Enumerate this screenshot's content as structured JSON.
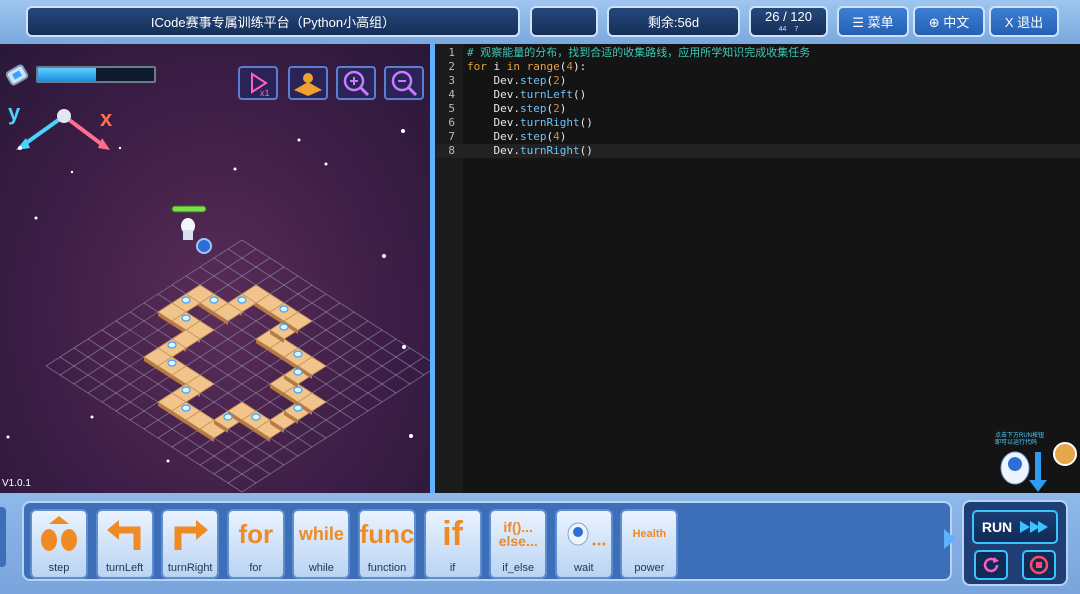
{
  "header": {
    "title": "ICode赛事专属训练平台（Python小高组）",
    "remaining": "剩余:56d",
    "counter_main": "26 / 120",
    "counter_sub_a": "44",
    "counter_sub_b": "7",
    "menu_label": "☰ 菜单",
    "lang_label": "⊕ 中文",
    "exit_label": "X 退出"
  },
  "game": {
    "version": "V1.0.1",
    "axis_y": "y",
    "axis_x": "x",
    "energy_fraction": 0.5
  },
  "editor": {
    "lines": [
      {
        "num": "1",
        "code": "# 观察能量的分布，找到合适的收集路线，应用所学知识完成收集任务"
      },
      {
        "num": "2",
        "code": "for i in range(4):"
      },
      {
        "num": "3",
        "code": "    Dev.step(2)"
      },
      {
        "num": "4",
        "code": "    Dev.turnLeft()"
      },
      {
        "num": "5",
        "code": "    Dev.step(2)"
      },
      {
        "num": "6",
        "code": "    Dev.turnRight()"
      },
      {
        "num": "7",
        "code": "    Dev.step(4)"
      },
      {
        "num": "8",
        "code": "    Dev.turnRight()"
      }
    ]
  },
  "toolbar": {
    "blocks": [
      {
        "label": "step",
        "icon": "step-icon"
      },
      {
        "label": "turnLeft",
        "icon": "turn-left-icon"
      },
      {
        "label": "turnRight",
        "icon": "turn-right-icon"
      },
      {
        "label": "for",
        "icon_text": "for"
      },
      {
        "label": "while",
        "icon_text": "while"
      },
      {
        "label": "function",
        "icon_text": "func"
      },
      {
        "label": "if",
        "icon_text": "if"
      },
      {
        "label": "if_else",
        "icon_text": "if()...\nelse..."
      },
      {
        "label": "wait",
        "icon": "robot-wait-icon"
      },
      {
        "label": "power",
        "icon_text": "Health"
      }
    ],
    "run_label": "RUN",
    "robot_hint": "点击下方RUN按钮\n即可以运行代码"
  },
  "colors": {
    "accent": "#3bc3ff",
    "block_orange": "#f08a24"
  }
}
